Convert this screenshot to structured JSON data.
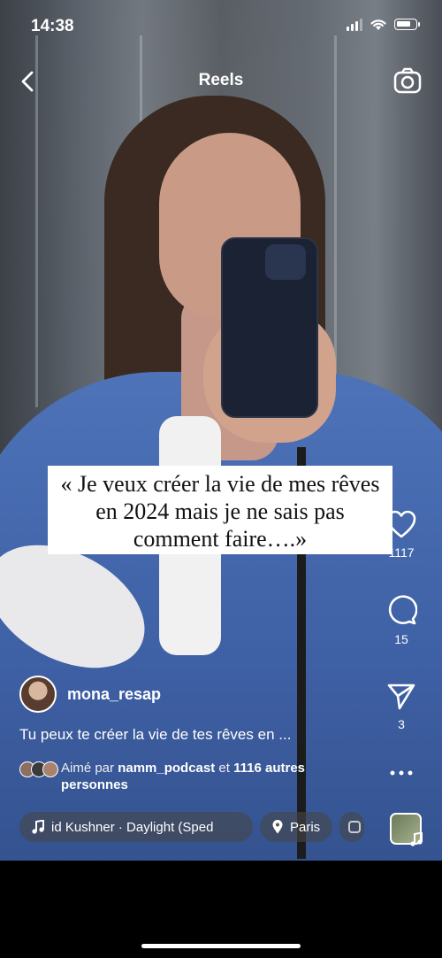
{
  "status_bar": {
    "time": "14:38"
  },
  "header": {
    "title": "Reels"
  },
  "video": {
    "overlay_text": "«  Je veux créer la vie de mes rêves en 2024 mais je ne sais pas comment faire….»"
  },
  "actions": {
    "like_count": "1117",
    "comment_count": "15",
    "share_count": "3"
  },
  "post": {
    "username": "mona_resap",
    "caption": "Tu peux te créer la vie de tes rêves en ...",
    "likes_prefix": "Aimé par ",
    "likes_user": "namm_podcast",
    "likes_middle": " et ",
    "likes_count_text": "1116 autres",
    "likes_suffix": " personnes"
  },
  "chips": {
    "music": "id Kushner · Daylight (Sped",
    "location": "Paris"
  },
  "icons": [
    "back-arrow-icon",
    "camera-icon",
    "heart-icon",
    "comment-icon",
    "send-icon",
    "more-icon",
    "music-note-icon",
    "location-pin-icon"
  ]
}
